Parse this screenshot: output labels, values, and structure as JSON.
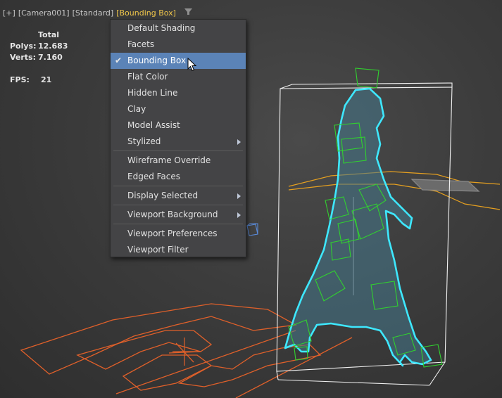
{
  "viewport": {
    "labels": [
      "[+]",
      "[Camera001]",
      "[Standard]",
      "[Bounding Box]"
    ],
    "active_label_index": 3,
    "stats": {
      "header": "Total",
      "polys_label": "Polys:",
      "polys_value": "12.683",
      "verts_label": "Verts:",
      "verts_value": "7.160",
      "fps_label": "FPS:",
      "fps_value": "21"
    },
    "icons": [
      "filter-icon"
    ]
  },
  "menu": {
    "items": [
      {
        "label": "Default Shading"
      },
      {
        "label": "Facets"
      },
      {
        "label": "Bounding Box",
        "checked": true,
        "selected": true
      },
      {
        "label": "Flat Color"
      },
      {
        "label": "Hidden Line"
      },
      {
        "label": "Clay"
      },
      {
        "label": "Model Assist"
      },
      {
        "label": "Stylized",
        "submenu": true
      },
      {
        "label": "Wireframe Override"
      },
      {
        "label": "Edged Faces"
      },
      {
        "label": "Display Selected",
        "submenu": true
      },
      {
        "label": "Viewport Background",
        "submenu": true
      },
      {
        "label": "Viewport Preferences"
      },
      {
        "label": "Viewport Filter"
      }
    ]
  },
  "colors": {
    "selection_cyan": "#3ee8ff",
    "bbox_green": "#31d12f",
    "spline_orange": "#e0602a",
    "path_yellow": "#e6a020",
    "menu_highlight": "#5b83b7",
    "active_label": "#f0c64a"
  }
}
